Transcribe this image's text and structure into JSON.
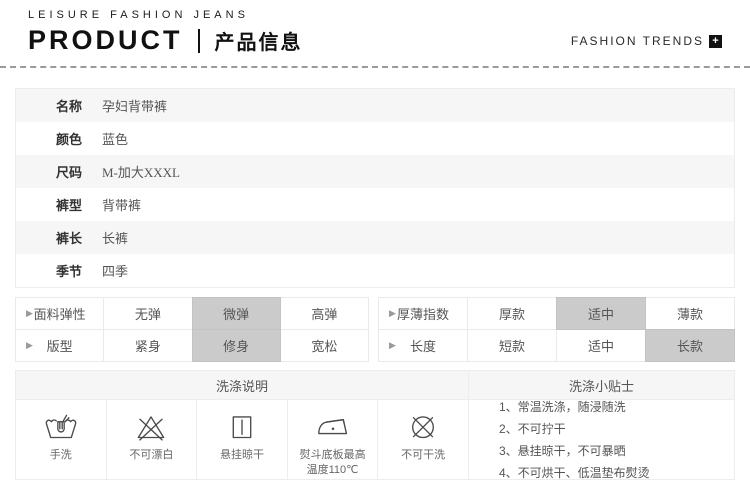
{
  "header": {
    "brand_small": "LEISURE FASHION JEANS",
    "title_en": "PRODUCT",
    "title_cn": "产品信息",
    "right_text": "FASHION TRENDS",
    "right_icon": "plus-square-icon"
  },
  "info_table": {
    "rows": [
      {
        "label": "名称",
        "value": "孕妇背带裤"
      },
      {
        "label": "颜色",
        "value": "蓝色"
      },
      {
        "label": "尺码",
        "value": "M-加大XXXL"
      },
      {
        "label": "裤型",
        "value": "背带裤"
      },
      {
        "label": "裤长",
        "value": "长裤"
      },
      {
        "label": "季节",
        "value": "四季"
      }
    ]
  },
  "attributes": {
    "groups": [
      {
        "label": "面料弹性",
        "options": [
          "无弹",
          "微弹",
          "高弹"
        ],
        "selected": 1
      },
      {
        "label": "厚薄指数",
        "options": [
          "厚款",
          "适中",
          "薄款"
        ],
        "selected": 1
      },
      {
        "label": "版型",
        "options": [
          "紧身",
          "修身",
          "宽松"
        ],
        "selected": 1
      },
      {
        "label": "长度",
        "options": [
          "短款",
          "适中",
          "长款"
        ],
        "selected": 2
      }
    ]
  },
  "washing": {
    "instructions_title": "洗涤说明",
    "tips_title": "洗涤小贴士",
    "icons": [
      {
        "name": "hand-wash-icon",
        "label": "手洗"
      },
      {
        "name": "no-bleach-icon",
        "label": "不可漂白"
      },
      {
        "name": "hang-dry-icon",
        "label": "悬挂晾干"
      },
      {
        "name": "iron-max-110-icon",
        "label": "熨斗底板最高温度110℃"
      },
      {
        "name": "no-dry-clean-icon",
        "label": "不可干洗"
      }
    ],
    "tips": [
      "1、常温洗涤，随浸随洗",
      "2、不可拧干",
      "3、悬挂晾干，不可暴晒",
      "4、不可烘干、低温垫布熨烫"
    ]
  },
  "colors": {
    "highlight": "#cbcbcb",
    "stripe": "#f6f6f6",
    "border": "#ededed",
    "text": "#555555",
    "heading": "#111111"
  }
}
